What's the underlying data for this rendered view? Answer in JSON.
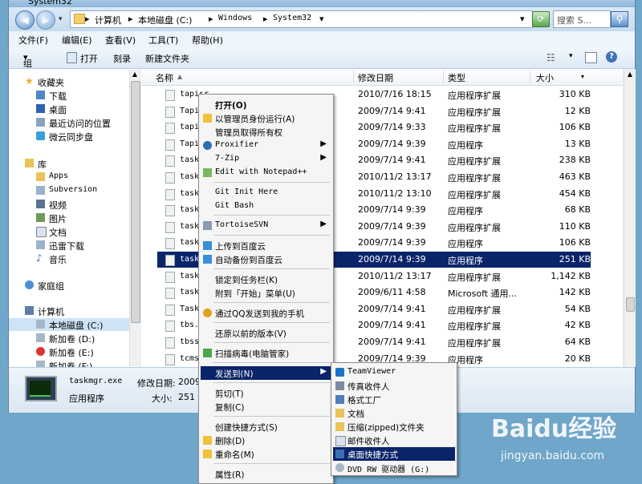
{
  "window": {
    "title": "System32"
  },
  "address": {
    "crumbs": [
      "计算机",
      "本地磁盘 (C:)",
      "Windows",
      "System32"
    ],
    "search_placeholder": "搜索 S..."
  },
  "menu": [
    "文件(F)",
    "编辑(E)",
    "查看(V)",
    "工具(T)",
    "帮助(H)"
  ],
  "toolbar": {
    "organize": "组织",
    "open": "打开",
    "burn": "刻录",
    "new_folder": "新建文件夹"
  },
  "nav": {
    "favorites": "收藏夹",
    "fav_items": [
      "下载",
      "桌面",
      "最近访问的位置",
      "微云同步盘"
    ],
    "libraries": "库",
    "lib_items": [
      "Apps",
      "Subversion",
      "视频",
      "图片",
      "文档",
      "迅雷下载",
      "音乐"
    ],
    "homegroup": "家庭组",
    "computer": "计算机",
    "drives": [
      "本地磁盘 (C:)",
      "新加卷 (D:)",
      "新加卷 (E:)",
      "新加卷 (F:)"
    ]
  },
  "columns": {
    "name": "名称",
    "date": "修改日期",
    "type": "类型",
    "size": "大小"
  },
  "files": [
    {
      "name": "tapisr",
      "date": "2010/7/16 18:15",
      "type": "应用程序扩展",
      "size": "310 KB"
    },
    {
      "name": "TapiSy",
      "date": "2009/7/14 9:41",
      "type": "应用程序扩展",
      "size": "12 KB"
    },
    {
      "name": "tapiui",
      "date": "2009/7/14 9:33",
      "type": "应用程序扩展",
      "size": "106 KB"
    },
    {
      "name": "TapiUn",
      "date": "2009/7/14 9:39",
      "type": "应用程序",
      "size": "13 KB"
    },
    {
      "name": "taskba",
      "date": "2009/7/14 9:41",
      "type": "应用程序扩展",
      "size": "238 KB"
    },
    {
      "name": "taskco",
      "date": "2010/11/2 13:17",
      "type": "应用程序扩展",
      "size": "463 KB"
    },
    {
      "name": "tasken",
      "date": "2010/11/2 13:10",
      "type": "应用程序扩展",
      "size": "454 KB"
    },
    {
      "name": "taskho",
      "date": "2009/7/14 9:39",
      "type": "应用程序",
      "size": "68 KB"
    },
    {
      "name": "taskki",
      "date": "2009/7/14 9:39",
      "type": "应用程序扩展",
      "size": "110 KB"
    },
    {
      "name": "taskli",
      "date": "2009/7/14 9:39",
      "type": "应用程序",
      "size": "106 KB"
    },
    {
      "name": "taskmg",
      "date": "2009/7/14 9:39",
      "type": "应用程序",
      "size": "251 KB"
    },
    {
      "name": "tasksc",
      "date": "2010/11/2 13:17",
      "type": "应用程序扩展",
      "size": "1,142 KB"
    },
    {
      "name": "tasksc",
      "date": "2009/6/11 4:58",
      "type": "Microsoft 通用...",
      "size": "142 KB"
    },
    {
      "name": "TaskSc",
      "date": "2009/7/14 9:41",
      "type": "应用程序扩展",
      "size": "54 KB"
    },
    {
      "name": "tbs.dl",
      "date": "2009/7/14 9:41",
      "type": "应用程序扩展",
      "size": "42 KB"
    },
    {
      "name": "tbssvc",
      "date": "2009/7/14 9:41",
      "type": "应用程序扩展",
      "size": "64 KB"
    },
    {
      "name": "tcmset",
      "date": "2009/7/14 9:39",
      "type": "应用程序",
      "size": "20 KB"
    }
  ],
  "details": {
    "filename": "taskmgr.exe",
    "date_label": "修改日期:",
    "date_value": "2009/",
    "type": "应用程序",
    "size_label": "大小:",
    "size_value": "251 K"
  },
  "context_menu": [
    "打开(O)",
    "以管理员身份运行(A)",
    "管理员取得所有权",
    "Proxifier",
    "7-Zip",
    "Edit with Notepad++",
    "Git Init Here",
    "Git Bash",
    "TortoiseSVN",
    "上传到百度云",
    "自动备份到百度云",
    "锁定到任务栏(K)",
    "附到「开始」菜单(U)",
    "通过QQ发送到我的手机",
    "还原以前的版本(V)",
    "扫描病毒(电脑管家)",
    "发送到(N)",
    "剪切(T)",
    "复制(C)",
    "创建快捷方式(S)",
    "删除(D)",
    "重命名(M)",
    "属性(R)"
  ],
  "send_to": [
    "TeamViewer",
    "传真收件人",
    "格式工厂",
    "文档",
    "压缩(zipped)文件夹",
    "邮件收件人",
    "桌面快捷方式",
    "DVD RW 驱动器 (G:)"
  ],
  "watermark": {
    "brand": "Baidu经验",
    "url": "jingyan.baidu.com"
  },
  "colors": {
    "selection": "#0a246a",
    "background": "#6fa6c9"
  }
}
